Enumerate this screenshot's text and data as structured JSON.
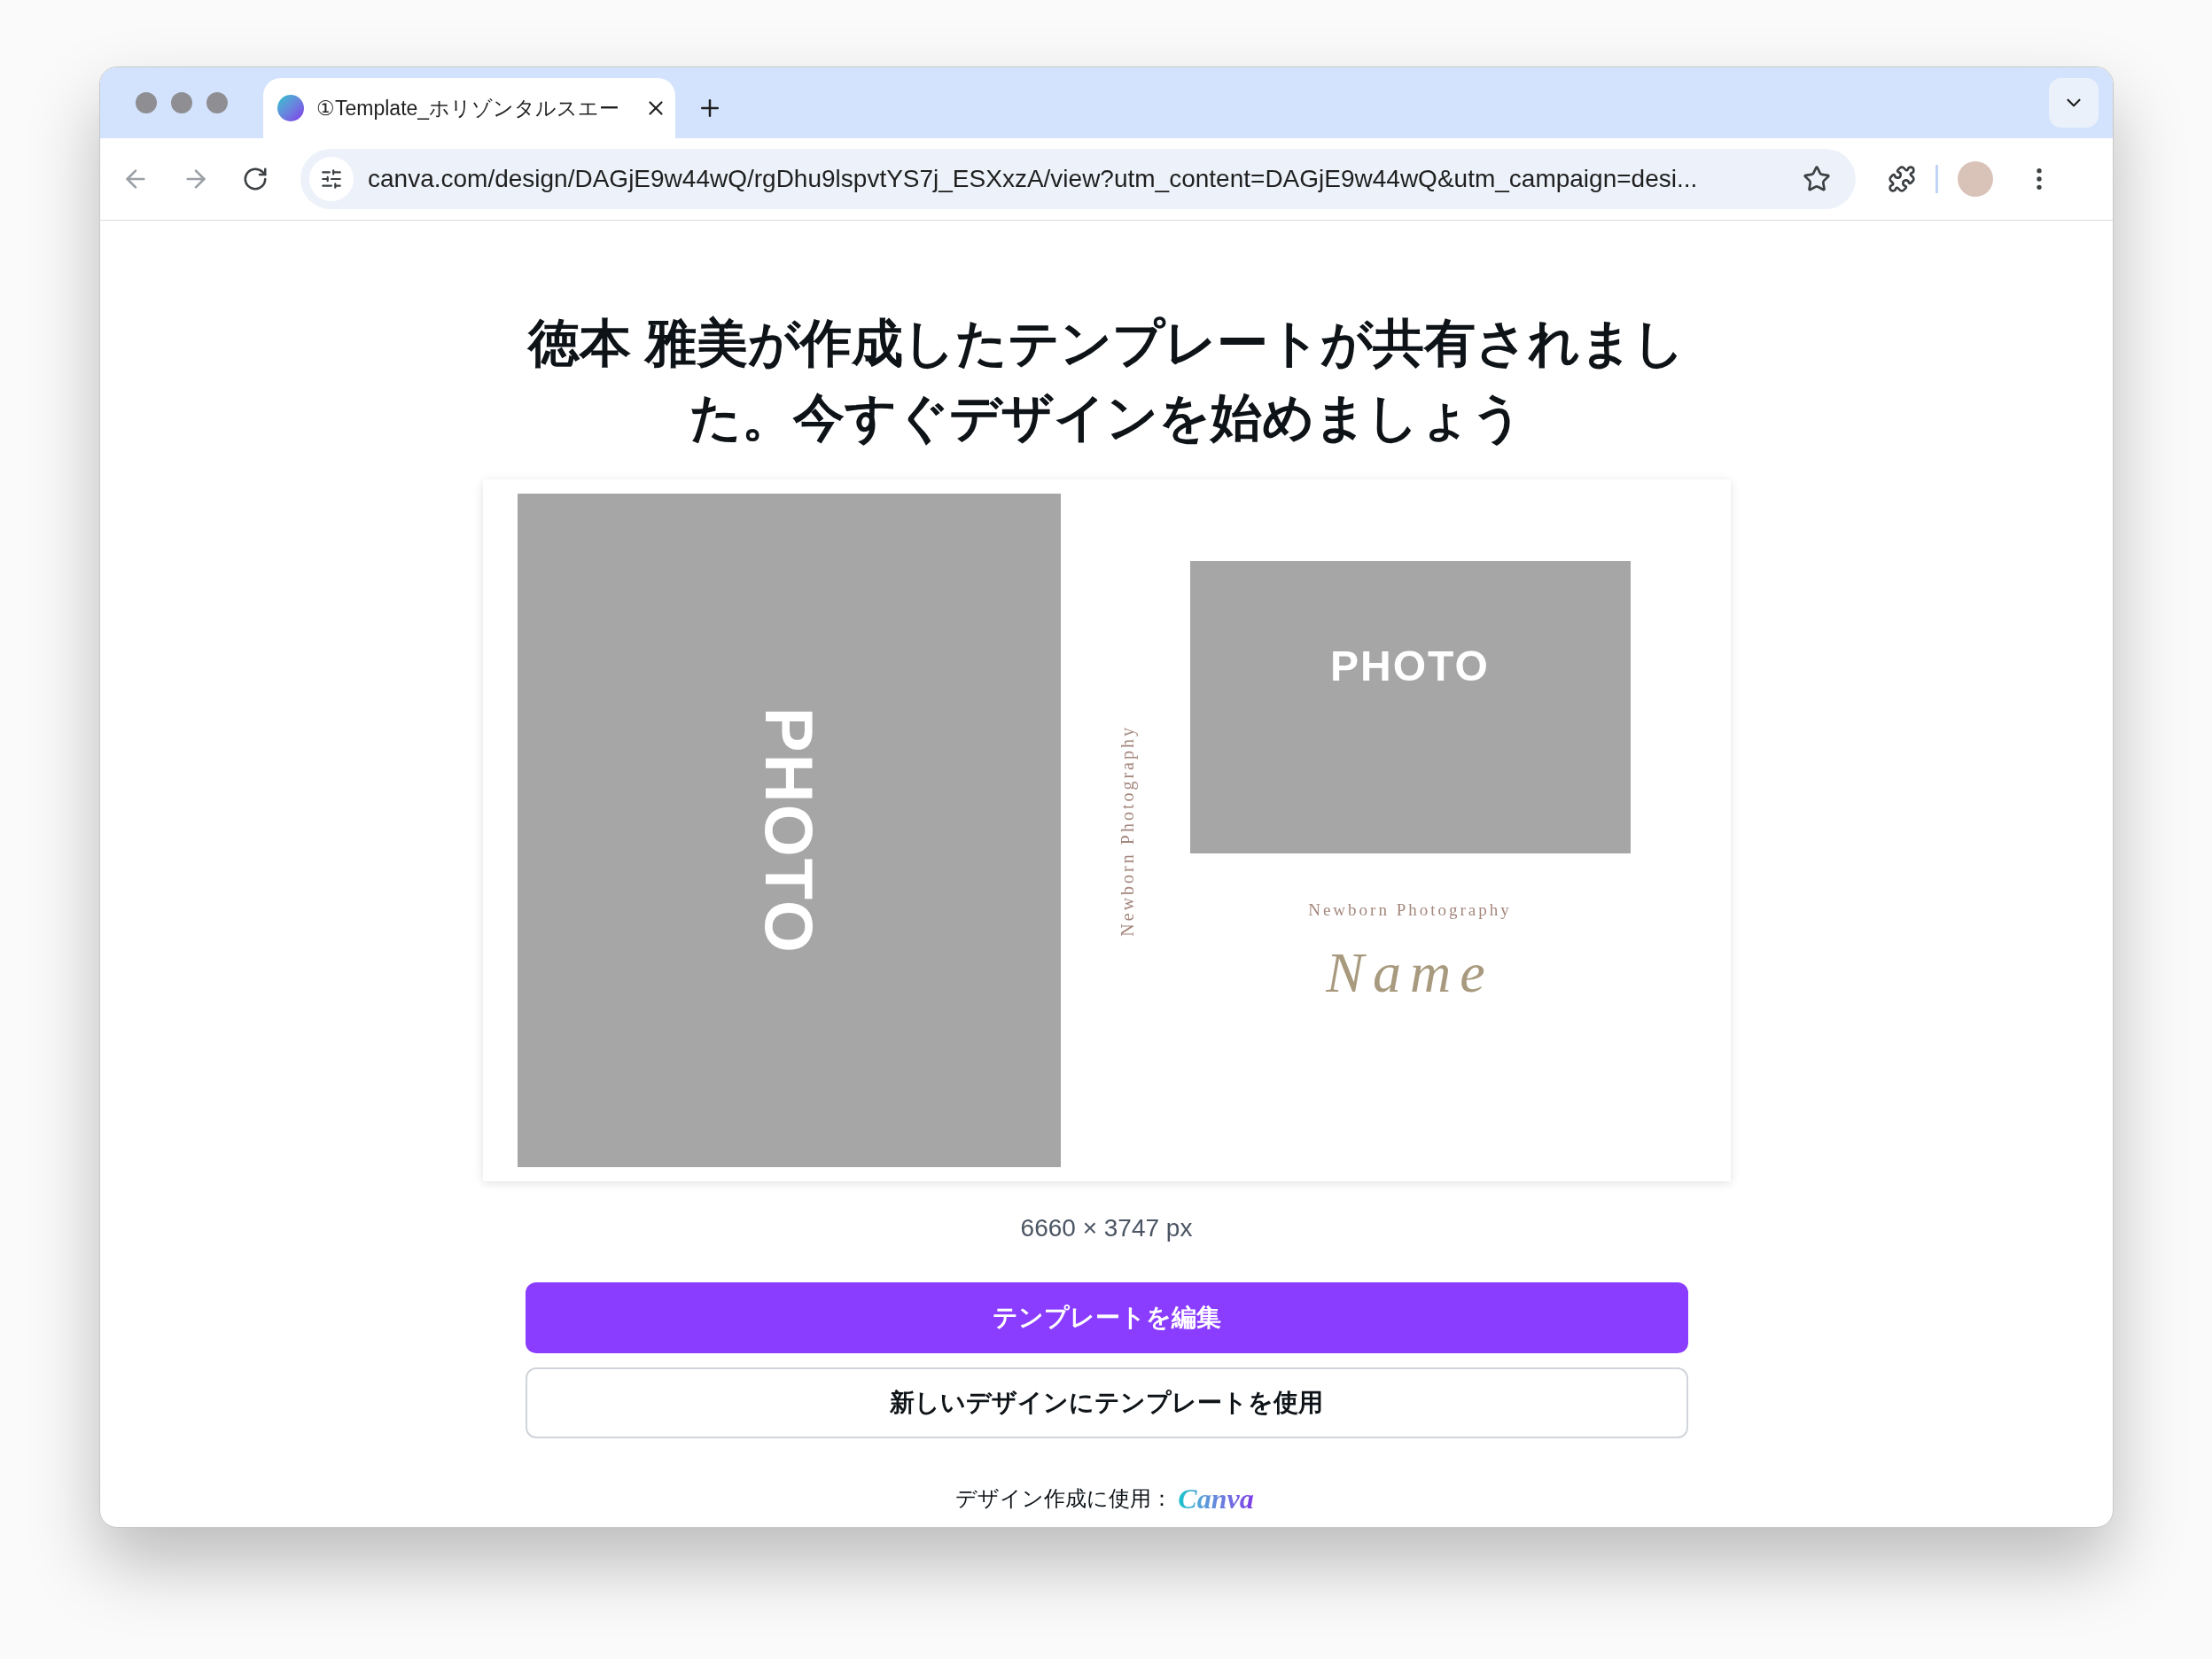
{
  "browser": {
    "tab": {
      "title": "①Template_ホリゾンタルスエー",
      "selected": true
    },
    "url": "canva.com/design/DAGjE9w44wQ/rgDhu9lspvtYS7j_ESXxzA/view?utm_content=DAGjE9w44wQ&utm_campaign=desi..."
  },
  "page": {
    "heading": "徳本 雅美が作成したテンプレートが共有されました。今すぐデザインを始めましょう",
    "preview": {
      "left_photo_label": "PHOTO",
      "spine_text": "Newborn Photography",
      "right_photo_label": "PHOTO",
      "subtitle": "Newborn Photography",
      "name_script": "Name"
    },
    "dimensions": "6660 × 3747 px",
    "buttons": [
      {
        "label": "テンプレートを編集",
        "kind": "primary"
      },
      {
        "label": "新しいデザインにテンプレートを使用",
        "kind": "secondary"
      }
    ],
    "footer": {
      "text": "デザイン作成に使用：",
      "brand": "Canva"
    }
  }
}
